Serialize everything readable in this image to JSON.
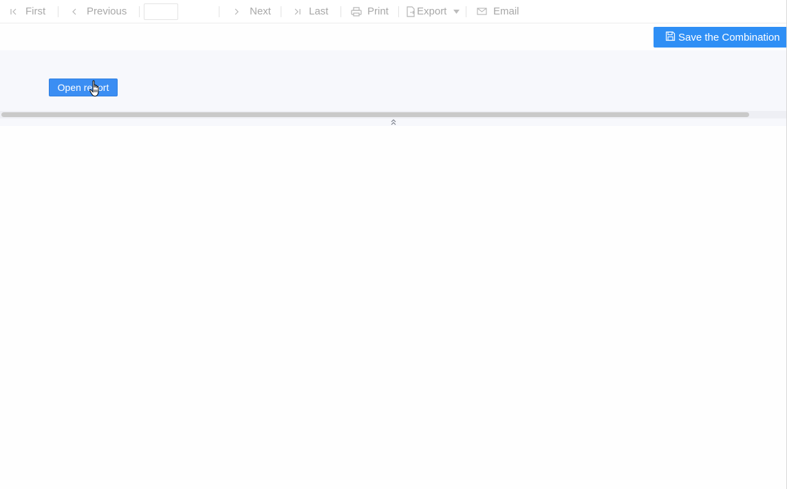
{
  "toolbar": {
    "first_label": "First",
    "previous_label": "Previous",
    "page_input_value": "",
    "next_label": "Next",
    "last_label": "Last",
    "print_label": "Print",
    "export_label": "Export",
    "email_label": "Email"
  },
  "actions": {
    "save_combination_label": "Save the Combination"
  },
  "panel": {
    "open_report_label": "Open report"
  },
  "colors": {
    "accent": "#2f8ff5",
    "toolbar_text_disabled": "#a8a8a8",
    "panel_background": "#f7f8fc"
  },
  "icons": {
    "first": "first-page-icon",
    "previous": "chevron-left-icon",
    "next": "chevron-right-icon",
    "last": "last-page-icon",
    "print": "printer-icon",
    "export": "export-icon",
    "export_dropdown": "caret-down-icon",
    "email": "envelope-icon",
    "save": "floppy-disk-icon",
    "collapse": "double-chevron-up-icon",
    "cursor": "hand-pointer-icon"
  }
}
